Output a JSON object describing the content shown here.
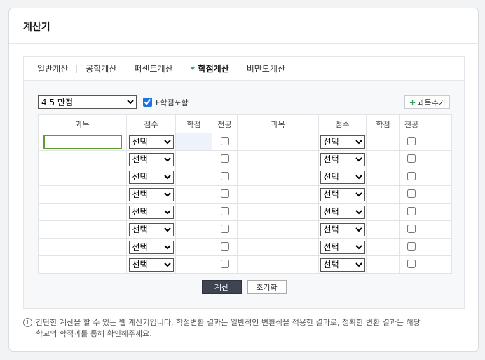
{
  "page_title": "계산기",
  "tabs": [
    {
      "label": "일반계산",
      "active": false
    },
    {
      "label": "공학계산",
      "active": false
    },
    {
      "label": "퍼센트계산",
      "active": false
    },
    {
      "label": "학점계산",
      "active": true
    },
    {
      "label": "비만도계산",
      "active": false
    }
  ],
  "scale": {
    "selected": "4.5 만점"
  },
  "f_include": {
    "label": "F학점포함",
    "checked": true
  },
  "add_course_label": "과목추가",
  "table": {
    "headers": [
      "과목",
      "점수",
      "학점",
      "전공",
      "과목",
      "점수",
      "학점",
      "전공"
    ],
    "grade_default": "선택",
    "row_count": 8
  },
  "buttons": {
    "calculate": "계산",
    "reset": "초기화"
  },
  "notice": {
    "icon": "info-icon",
    "line1": "간단한 계산을 할 수 있는 웹 계산기입니다. 학점변환 결과는 일반적인 변환식을 적용한 결과로, 정확한 변환 결과는 해당",
    "line2": "학교의 학적과를 통해 확인해주세요."
  },
  "colors": {
    "accent_green": "#3aa35b",
    "focus_border": "#5a9e2f",
    "calc_button": "#3f4453"
  }
}
